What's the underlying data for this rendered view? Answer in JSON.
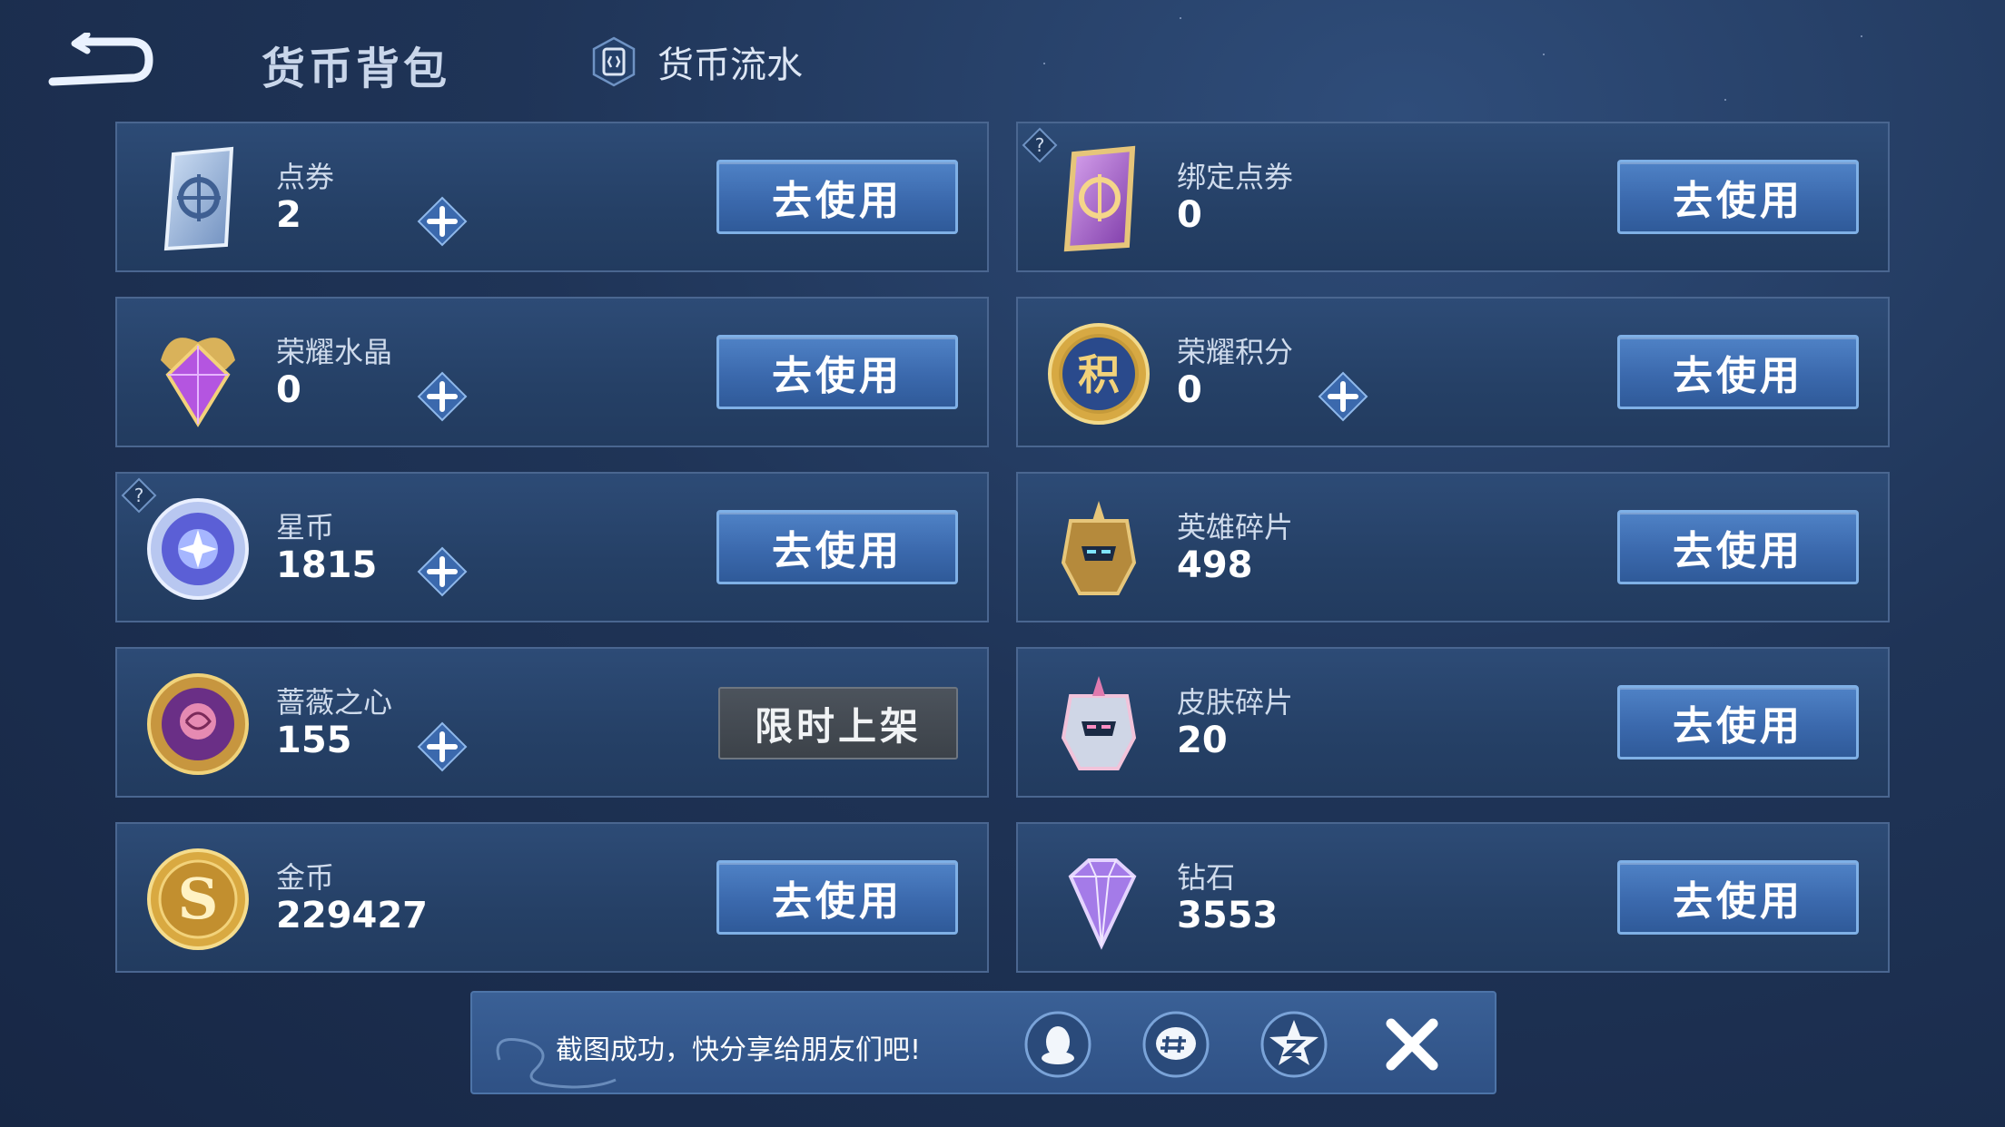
{
  "header": {
    "title": "货币背包",
    "flow_label": "货币流水"
  },
  "currencies": [
    {
      "name": "点券",
      "amount": "2",
      "action": "去使用",
      "plus": true,
      "help": false,
      "icon": "ticket-icon"
    },
    {
      "name": "绑定点券",
      "amount": "0",
      "action": "去使用",
      "plus": false,
      "help": true,
      "icon": "bound-ticket-icon"
    },
    {
      "name": "荣耀水晶",
      "amount": "0",
      "action": "去使用",
      "plus": true,
      "help": false,
      "icon": "glory-crystal-icon"
    },
    {
      "name": "荣耀积分",
      "amount": "0",
      "action": "去使用",
      "plus": true,
      "help": false,
      "icon": "glory-points-icon"
    },
    {
      "name": "星币",
      "amount": "1815",
      "action": "去使用",
      "plus": true,
      "help": true,
      "icon": "star-coin-icon"
    },
    {
      "name": "英雄碎片",
      "amount": "498",
      "action": "去使用",
      "plus": false,
      "help": false,
      "icon": "hero-shard-icon"
    },
    {
      "name": "蔷薇之心",
      "amount": "155",
      "action": "限时上架",
      "plus": true,
      "help": false,
      "icon": "rose-heart-icon"
    },
    {
      "name": "皮肤碎片",
      "amount": "20",
      "action": "去使用",
      "plus": false,
      "help": false,
      "icon": "skin-shard-icon"
    },
    {
      "name": "金币",
      "amount": "229427",
      "action": "去使用",
      "plus": false,
      "help": false,
      "icon": "gold-coin-icon"
    },
    {
      "name": "钻石",
      "amount": "3553",
      "action": "去使用",
      "plus": false,
      "help": false,
      "icon": "diamond-icon"
    }
  ],
  "share_bar": {
    "message": "截图成功，快分享给朋友们吧!",
    "icons": [
      "qq-icon",
      "wechat-icon",
      "qzone-icon"
    ]
  },
  "colors": {
    "background": "#1f3457",
    "card": "#2a4670",
    "card_border": "#4a6690",
    "button": "#3b69ad",
    "button_border": "#7fb0e6",
    "limited_button": "#434a52"
  }
}
